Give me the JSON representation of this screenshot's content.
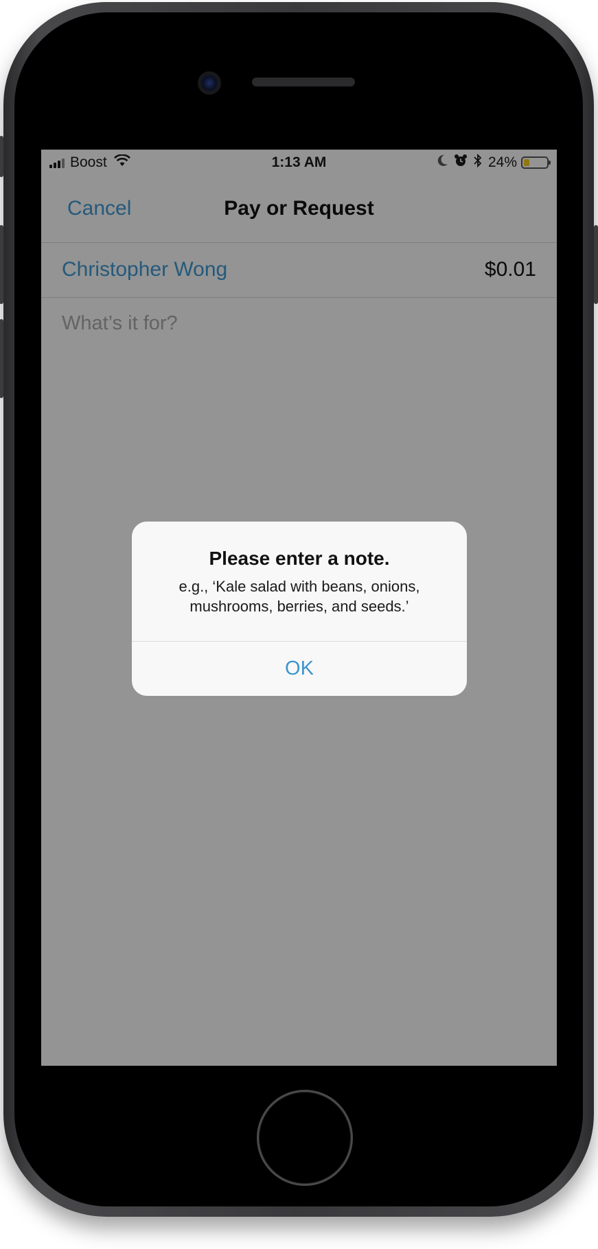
{
  "status_bar": {
    "carrier": "Boost",
    "time": "1:13 AM",
    "battery_percent": "24%",
    "battery_level": 0.24,
    "battery_color": "#f4c51b",
    "icons": [
      "signal-icon",
      "wifi-icon",
      "moon-icon",
      "alarm-icon",
      "bluetooth-icon",
      "battery-icon"
    ]
  },
  "nav": {
    "cancel_label": "Cancel",
    "title": "Pay or Request"
  },
  "payment": {
    "recipient": "Christopher Wong",
    "amount": "$0.01"
  },
  "note": {
    "placeholder": "What’s it for?",
    "value": ""
  },
  "alert": {
    "title": "Please enter a note.",
    "message": "e.g., ‘Kale salad with beans, onions, mushrooms, berries, and seeds.’",
    "ok_label": "OK"
  },
  "colors": {
    "accent": "#3d95ce",
    "overlay": "rgba(0,0,0,0.4)"
  }
}
